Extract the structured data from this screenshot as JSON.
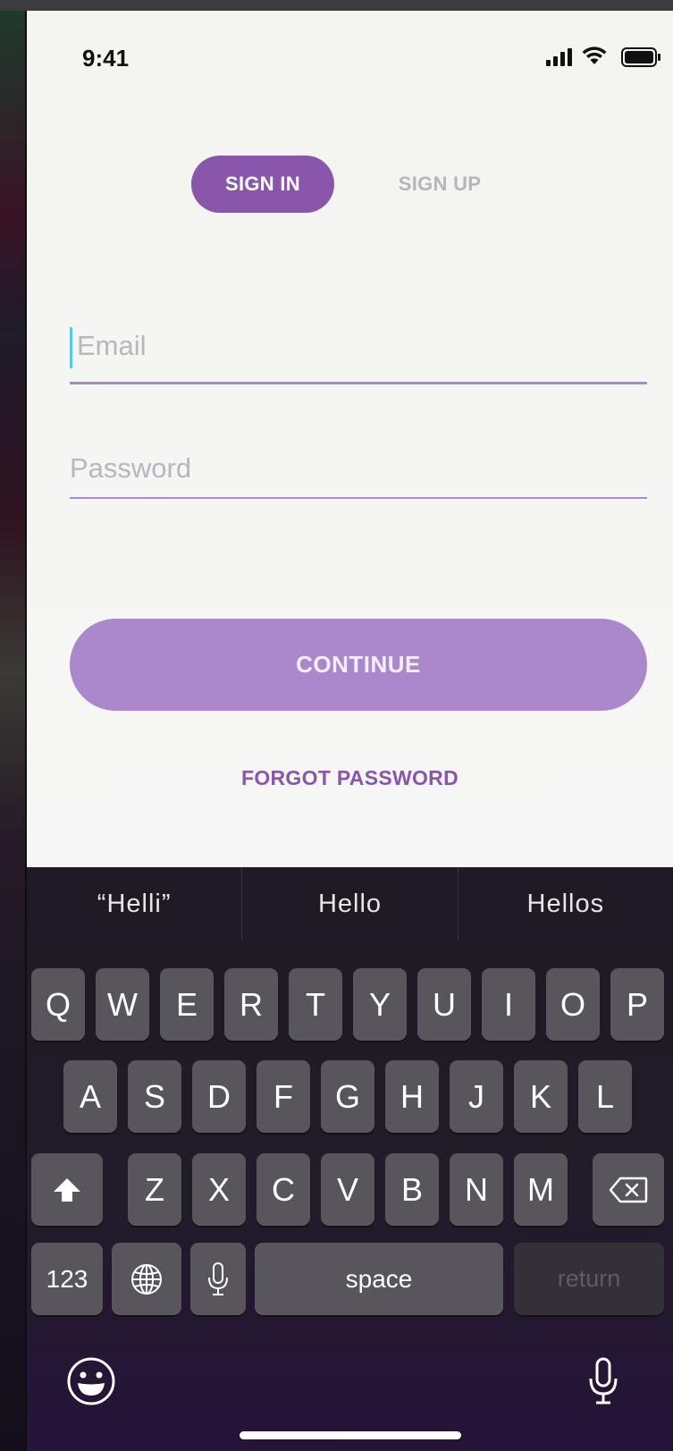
{
  "status": {
    "time": "9:41"
  },
  "tabs": {
    "signin": "SIGN IN",
    "signup": "SIGN UP"
  },
  "form": {
    "email_placeholder": "Email",
    "password_placeholder": "Password",
    "continue_label": "CONTINUE",
    "forgot_label": "FORGOT PASSWORD"
  },
  "colors": {
    "accent": "#8a56ac",
    "button": "#ab88cc",
    "field_line": "#ad88cf"
  },
  "keyboard": {
    "predictions": [
      "“Helli”",
      "Hello",
      "Hellos"
    ],
    "row1": [
      "Q",
      "W",
      "E",
      "R",
      "T",
      "Y",
      "U",
      "I",
      "O",
      "P"
    ],
    "row2": [
      "A",
      "S",
      "D",
      "F",
      "G",
      "H",
      "J",
      "K",
      "L"
    ],
    "row3": [
      "Z",
      "X",
      "C",
      "V",
      "B",
      "N",
      "M"
    ],
    "numbers": "123",
    "space": "space",
    "return": "return"
  },
  "icons": [
    "signal-icon",
    "wifi-icon",
    "battery-icon",
    "shift-icon",
    "backspace-icon",
    "globe-icon",
    "mic-icon",
    "emoji-icon",
    "dictation-icon"
  ]
}
